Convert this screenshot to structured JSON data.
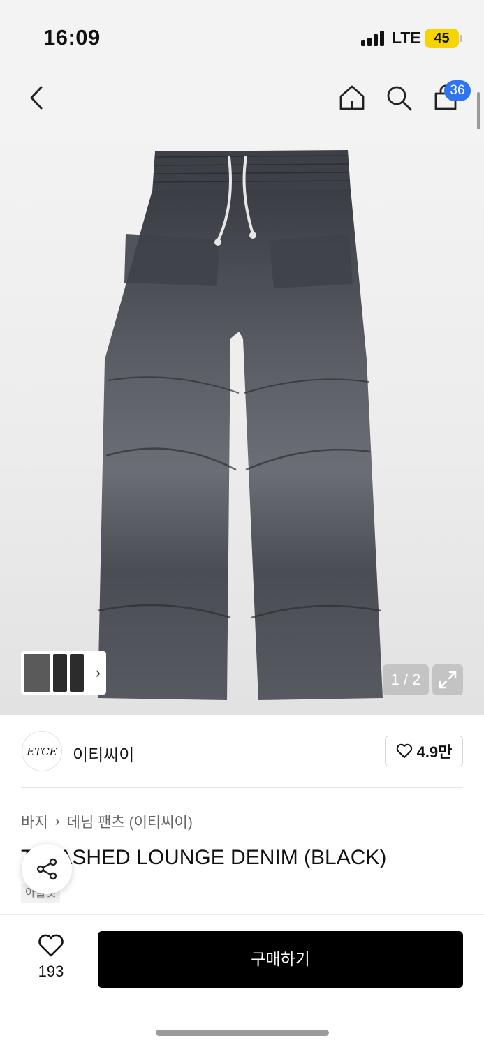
{
  "status_bar": {
    "time": "16:09",
    "network": "LTE",
    "battery": "45"
  },
  "nav": {
    "cart_count": "36"
  },
  "gallery": {
    "counter": "1 / 2"
  },
  "brand": {
    "logo_text": "ETCE",
    "name": "이티씨이",
    "likes": "4.9만"
  },
  "breadcrumb": {
    "category": "바지",
    "sub_category": "데님 팬츠 (이티씨이)"
  },
  "product": {
    "title": "T WASHED LOUNGE DENIM (BLACK)",
    "tag": "아울렛"
  },
  "bottom": {
    "wish_count": "193",
    "buy_label": "구매하기"
  },
  "colors": {
    "accent_badge": "#2f74f0",
    "buy_button": "#000000",
    "battery": "#f6d400"
  },
  "icons": [
    "back-icon",
    "home-icon",
    "search-icon",
    "cart-icon",
    "expand-icon",
    "heart-icon",
    "share-icon",
    "chevron-right-icon"
  ]
}
